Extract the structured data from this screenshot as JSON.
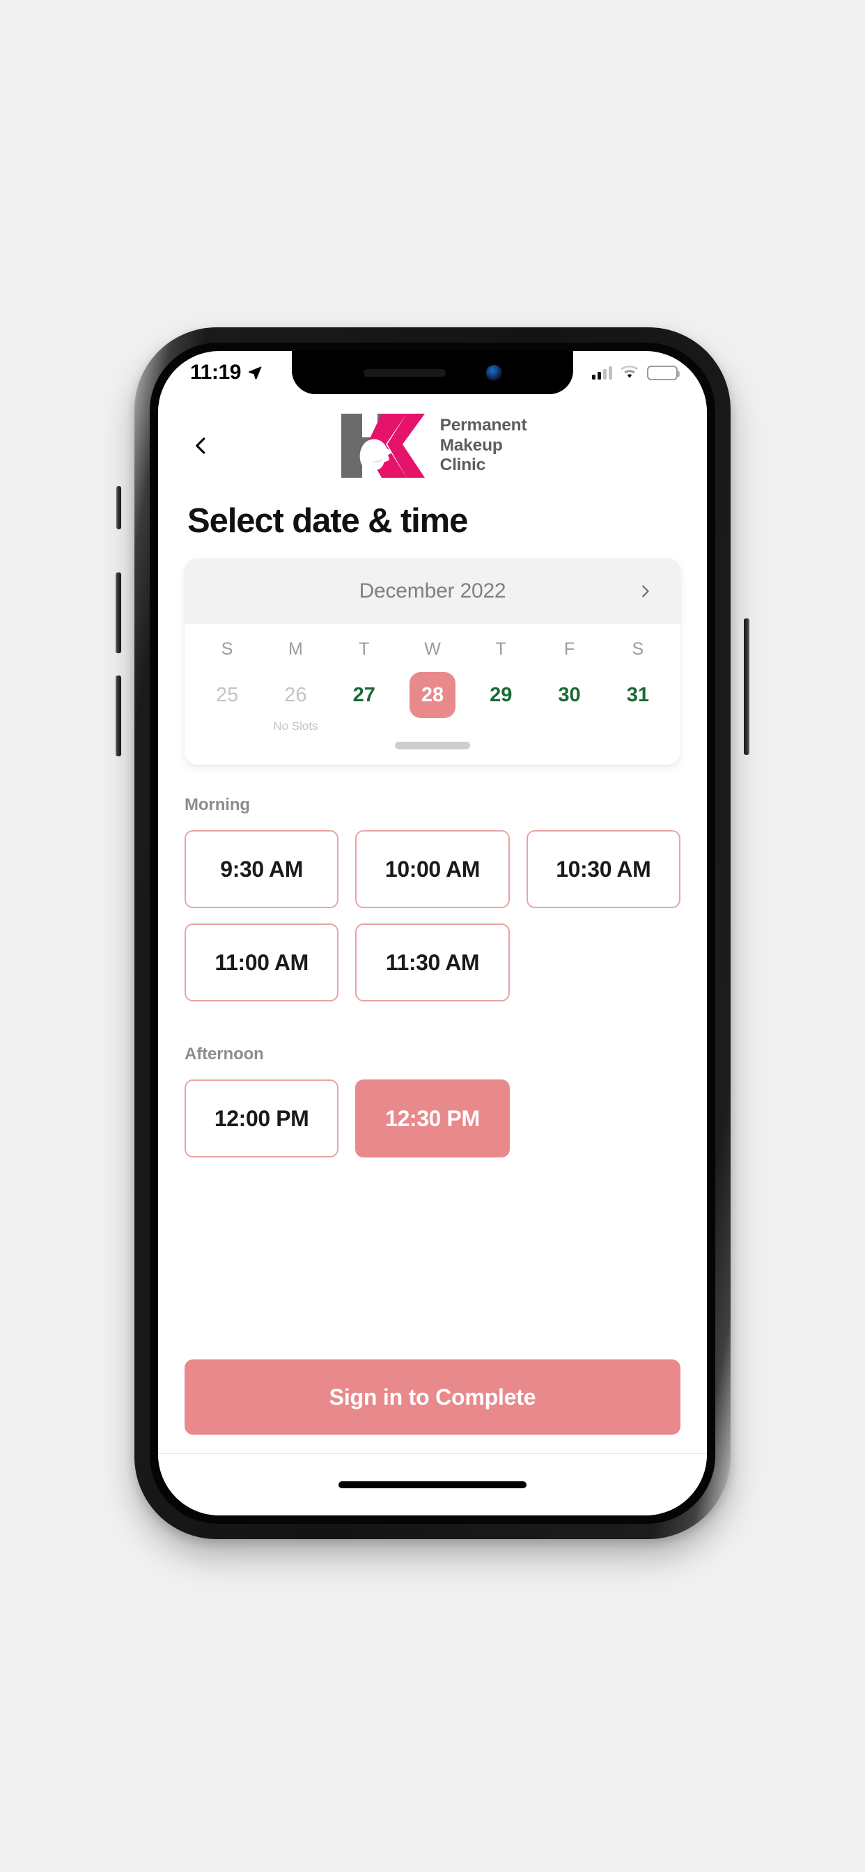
{
  "status_bar": {
    "time": "11:19",
    "location_icon": "location-arrow-icon",
    "cellular_icon": "cellular-bars-icon",
    "wifi_icon": "wifi-icon",
    "battery_icon": "battery-icon",
    "battery_color": "#ffc800"
  },
  "appbar": {
    "back_icon": "chevron-left-icon",
    "logo_mark": "hk-monogram-logo",
    "logo_line1": "Permanent",
    "logo_line2": "Makeup",
    "logo_line3": "Clinic"
  },
  "page": {
    "title": "Select date & time"
  },
  "calendar": {
    "month_label": "December 2022",
    "next_icon": "chevron-right-icon",
    "day_headers": [
      "S",
      "M",
      "T",
      "W",
      "T",
      "F",
      "S"
    ],
    "days": [
      {
        "number": "25",
        "state": "disabled",
        "note": ""
      },
      {
        "number": "26",
        "state": "disabled",
        "note": "No Slots"
      },
      {
        "number": "27",
        "state": "available",
        "note": ""
      },
      {
        "number": "28",
        "state": "selected",
        "note": ""
      },
      {
        "number": "29",
        "state": "available",
        "note": ""
      },
      {
        "number": "30",
        "state": "available",
        "note": ""
      },
      {
        "number": "31",
        "state": "available",
        "note": ""
      }
    ],
    "selected_day": "28",
    "scroll_indicator": "page-indicator"
  },
  "slots": {
    "morning": {
      "label": "Morning",
      "times": [
        {
          "label": "9:30 AM",
          "selected": false
        },
        {
          "label": "10:00 AM",
          "selected": false
        },
        {
          "label": "10:30 AM",
          "selected": false
        },
        {
          "label": "11:00 AM",
          "selected": false
        },
        {
          "label": "11:30 AM",
          "selected": false
        }
      ]
    },
    "afternoon": {
      "label": "Afternoon",
      "times": [
        {
          "label": "12:00 PM",
          "selected": false
        },
        {
          "label": "12:30 PM",
          "selected": true
        }
      ]
    }
  },
  "cta": {
    "label": "Sign in to Complete"
  },
  "colors": {
    "accent": "#e8898b",
    "accent_border": "#eaa3a4",
    "available_day": "#176b33",
    "disabled_day": "#c3c3c3",
    "brand_gray": "#6b6b6b",
    "brand_pink": "#e6136b",
    "page_background": "#f0f0f0"
  }
}
